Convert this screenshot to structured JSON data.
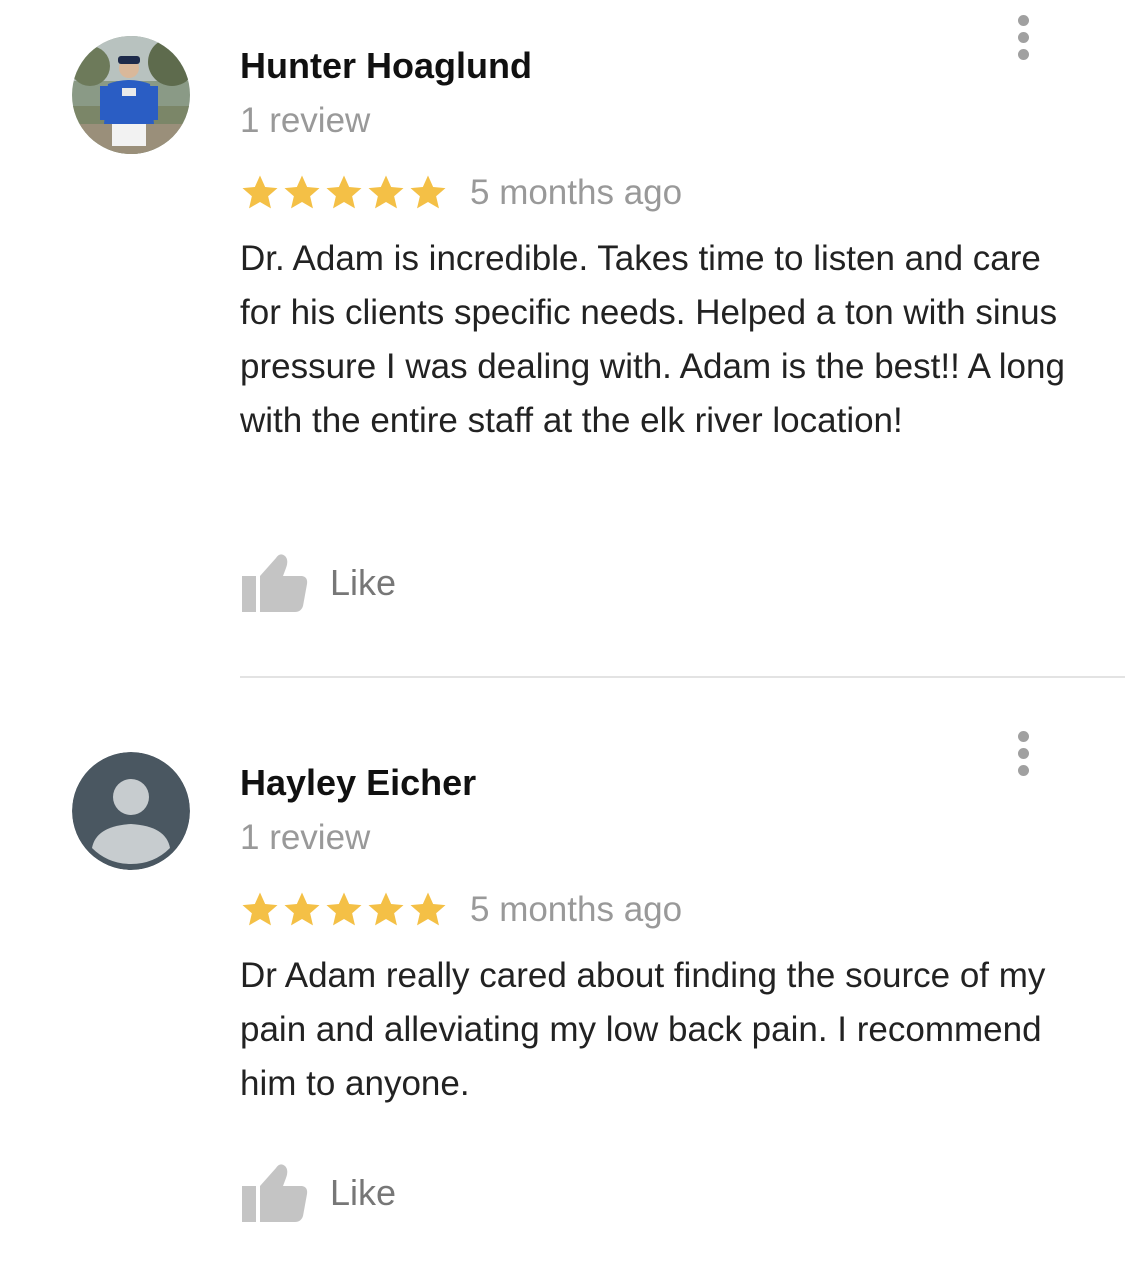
{
  "colors": {
    "star": "#F4C046",
    "secondary_text": "#999999",
    "like_icon": "#C4C4C4",
    "divider": "#E3E3E3"
  },
  "reviews": [
    {
      "author": "Hunter Hoaglund",
      "review_count": "1 review",
      "rating": 5,
      "time": "5 months ago",
      "text": "Dr. Adam is incredible. Takes time to listen and care for his clients specific needs. Helped a ton with sinus pressure I was dealing with. Adam is the best!! A long with the entire staff at the elk river location!",
      "like_label": "Like",
      "avatar": "photo-avatar-icon",
      "more_icon": "more-vert-icon",
      "like_icon": "thumbs-up-icon"
    },
    {
      "author": "Hayley Eicher",
      "review_count": "1 review",
      "rating": 5,
      "time": "5 months ago",
      "text": "Dr Adam really cared about finding the source of my pain and alleviating my low back pain. I recommend him to anyone.",
      "like_label": "Like",
      "avatar": "default-person-avatar-icon",
      "more_icon": "more-vert-icon",
      "like_icon": "thumbs-up-icon"
    }
  ]
}
